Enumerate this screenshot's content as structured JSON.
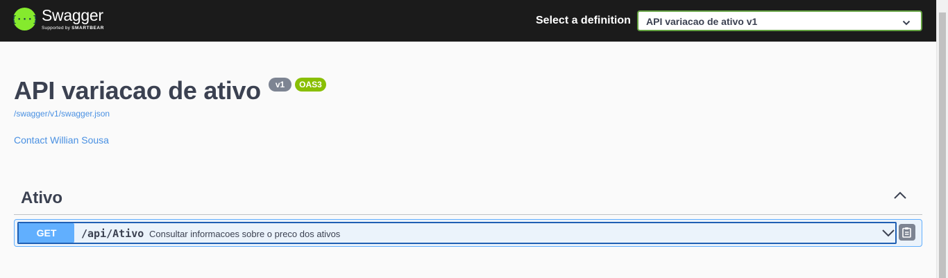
{
  "topbar": {
    "logo_name": "Swagger",
    "logo_sub_prefix": "Supported by",
    "logo_sub_brand": "SMARTBEAR",
    "definition_label": "Select a definition",
    "definition_selected": "API variacao de ativo v1"
  },
  "info": {
    "title": "API variacao de ativo",
    "version_badge": "v1",
    "oas_badge": "OAS3",
    "spec_url": "/swagger/v1/swagger.json",
    "contact": "Contact Willian Sousa"
  },
  "tags": [
    {
      "name": "Ativo",
      "expanded": true,
      "operations": [
        {
          "method": "GET",
          "path": "/api/Ativo",
          "summary": "Consultar informacoes sobre o preco dos ativos"
        }
      ]
    }
  ],
  "colors": {
    "topbar_bg": "#1b1b1b",
    "brand_green": "#85ea2d",
    "get_blue": "#61affe",
    "link_blue": "#4990e2",
    "oas_green": "#89bf04",
    "version_gray": "#7d8492"
  },
  "icons": {
    "logo": "swagger-logo-icon",
    "select_chevron": "chevron-down-icon",
    "tag_toggle": "chevron-up-icon",
    "op_toggle": "chevron-down-icon",
    "copy": "clipboard-copy-icon"
  }
}
